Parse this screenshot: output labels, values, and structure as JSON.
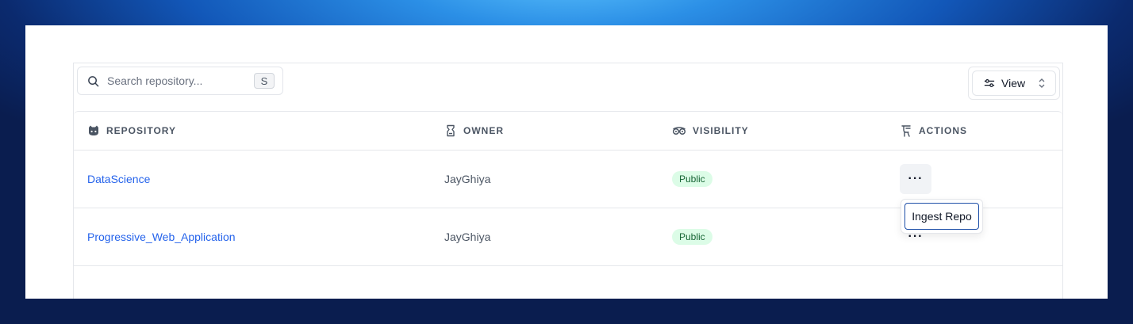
{
  "search": {
    "placeholder": "Search repository...",
    "value": "",
    "shortcut": "S"
  },
  "toolbar": {
    "view_label": "View"
  },
  "columns": {
    "repository": "REPOSITORY",
    "owner": "OWNER",
    "visibility": "VISIBILITY",
    "actions": "ACTIONS"
  },
  "rows": [
    {
      "repository": "DataScience",
      "owner": "JayGhiya",
      "visibility": "Public",
      "actions": "···"
    },
    {
      "repository": "Progressive_Web_Application",
      "owner": "JayGhiya",
      "visibility": "Public",
      "actions": "···"
    }
  ],
  "actions_menu": {
    "items": [
      {
        "label": "Ingest Repo"
      }
    ]
  },
  "colors": {
    "link": "#2563eb",
    "badge_bg": "#dcfce7",
    "badge_text": "#166534"
  },
  "icons": [
    "search-icon",
    "sliders-icon",
    "chevron-updown-icon",
    "github-icon",
    "owner-icon",
    "visibility-icon",
    "actions-icon"
  ]
}
